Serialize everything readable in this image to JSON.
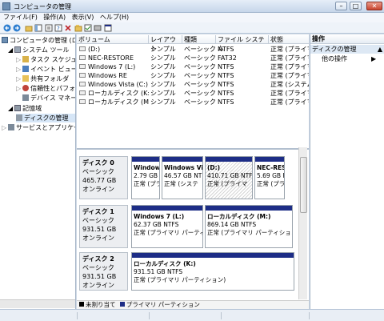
{
  "window": {
    "title": "コンピュータの管理"
  },
  "menu": [
    "ファイル(F)",
    "操作(A)",
    "表示(V)",
    "ヘルプ(H)"
  ],
  "tree": {
    "root": "コンピュータの管理 (ロ",
    "system_tools": "システム ツール",
    "task_scheduler": "タスク スケジュー",
    "event_viewer": "イベント ビューア",
    "shared_folders": "共有フォルダ",
    "reliability": "信頼性とパフォー",
    "device_manager": "デバイス マネージ",
    "storage": "記憶域",
    "disk_management": "ディスクの管理",
    "services_apps": "サービスとアプリケー"
  },
  "columns": [
    "ボリューム",
    "レイアウト",
    "種類",
    "ファイル システム",
    "状態"
  ],
  "volumes": [
    [
      "(D:)",
      "シンプル",
      "ベーシック",
      "NTFS",
      "正常 (プライマ"
    ],
    [
      "NEC-RESTORE",
      "シンプル",
      "ベーシック",
      "FAT32",
      "正常 (プライマ"
    ],
    [
      "Windows 7 (L:)",
      "シンプル",
      "ベーシック",
      "NTFS",
      "正常 (プライマ"
    ],
    [
      "Windows RE",
      "シンプル",
      "ベーシック",
      "NTFS",
      "正常 (プライマ"
    ],
    [
      "Windows Vista (C:)",
      "シンプル",
      "ベーシック",
      "NTFS",
      "正常 (システム"
    ],
    [
      "ローカルディスク (K:)",
      "シンプル",
      "ベーシック",
      "NTFS",
      "正常 (プライマ"
    ],
    [
      "ローカルディスク (M:)",
      "シンプル",
      "ベーシック",
      "NTFS",
      "正常 (プライマ"
    ]
  ],
  "disks": [
    {
      "name": "ディスク 0",
      "type": "ベーシック",
      "size": "465.77 GB",
      "status": "オンライン",
      "parts": [
        {
          "name": "Windows",
          "size": "2.79 GB N",
          "status": "正常 (プラ"
        },
        {
          "name": "Windows Vi",
          "size": "46.57 GB NT",
          "status": "正常 (システ"
        },
        {
          "name": "(D:)",
          "size": "410.71 GB NTF",
          "status": "正常 (プライマ"
        },
        {
          "name": "NEC-REST",
          "size": "5.69 GB F",
          "status": "正常 (プラ"
        }
      ]
    },
    {
      "name": "ディスク 1",
      "type": "ベーシック",
      "size": "931.51 GB",
      "status": "オンライン",
      "parts": [
        {
          "name": "Windows 7  (L:)",
          "size": "62.37 GB NTFS",
          "status": "正常 (プライマリ パーティ"
        },
        {
          "name": "ローカルディスク  (M:)",
          "size": "869.14 GB NTFS",
          "status": "正常 (プライマリ パーティション"
        }
      ]
    },
    {
      "name": "ディスク 2",
      "type": "ベーシック",
      "size": "931.51 GB",
      "status": "オンライン",
      "parts": [
        {
          "name": "ローカルディスク  (K:)",
          "size": "931.51 GB NTFS",
          "status": "正常 (プライマリ パーティション)"
        }
      ]
    }
  ],
  "legend": {
    "unallocated": "未割り当て",
    "primary": "プライマリ パーティション"
  },
  "actions": {
    "header": "操作",
    "section": "ディスクの管理",
    "other": "他の操作"
  },
  "colors": {
    "primary_partition": "#1d2d86",
    "unallocated": "#000000",
    "selection": "#d6e6f7"
  }
}
